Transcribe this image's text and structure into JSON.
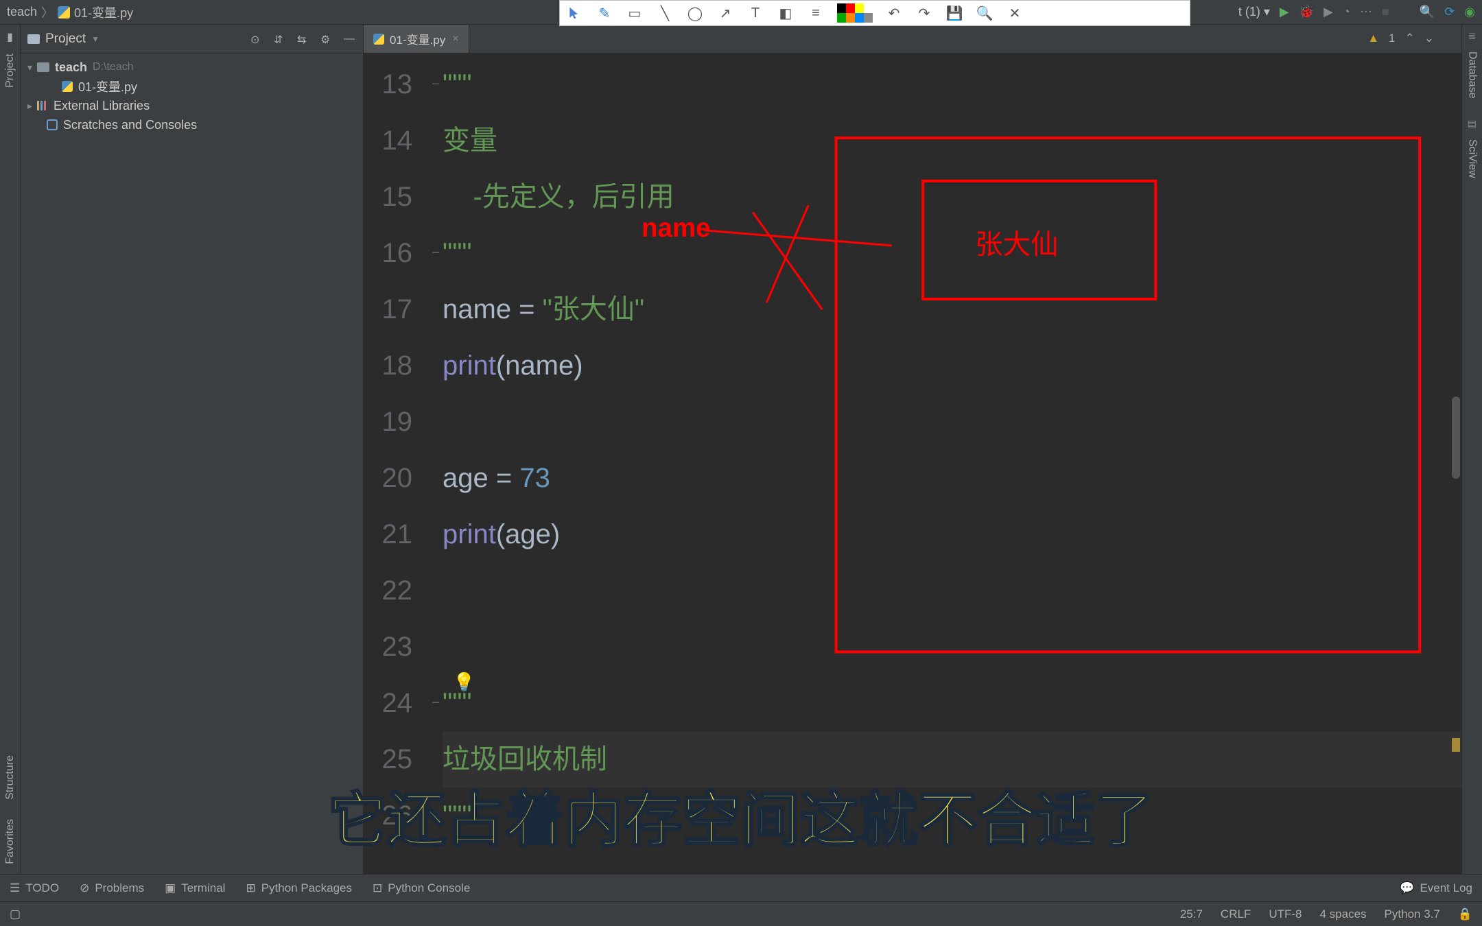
{
  "breadcrumb": {
    "project": "teach",
    "file": "01-变量.py"
  },
  "toolbar_right": {
    "run_config": "t (1)"
  },
  "project_panel": {
    "title": "Project",
    "root": {
      "name": "teach",
      "path": "D:\\teach"
    },
    "files": [
      "01-变量.py"
    ],
    "external": "External Libraries",
    "scratches": "Scratches and Consoles"
  },
  "tabs": [
    {
      "name": "01-变量.py"
    }
  ],
  "inspections": {
    "warn_count": "1"
  },
  "code_lines": [
    {
      "n": 13,
      "html": "<span class='s-doc'>\"\"\"</span>",
      "fold": "−"
    },
    {
      "n": 14,
      "html": "<span class='s-doc'>变量</span>"
    },
    {
      "n": 15,
      "html": "<span class='s-doc'>    -先定义，后引用</span>"
    },
    {
      "n": 16,
      "html": "<span class='s-doc'>\"\"\"</span>",
      "fold": "−"
    },
    {
      "n": 17,
      "html": "name = <span class='s-str'>\"张大仙\"</span>"
    },
    {
      "n": 18,
      "html": "<span class='s-fn'>print</span>(name)"
    },
    {
      "n": 19,
      "html": ""
    },
    {
      "n": 20,
      "html": "age = <span class='s-num'>73</span>"
    },
    {
      "n": 21,
      "html": "<span class='s-fn'>print</span>(age)"
    },
    {
      "n": 22,
      "html": ""
    },
    {
      "n": 23,
      "html": ""
    },
    {
      "n": 24,
      "html": "<span class='s-doc'>\"\"\"</span>",
      "fold": "−"
    },
    {
      "n": 25,
      "html": "<span class='s-doc'>垃圾回收机制</span>",
      "caret": true
    },
    {
      "n": 26,
      "html": "<span class='s-doc'>\"\"\"</span>",
      "fold": "−"
    }
  ],
  "annotation": {
    "label_text": "name",
    "box_text": "张大仙",
    "color": "#ff0000"
  },
  "subtitle": "它还占着内存空间这就不合适了",
  "bottom_tools": {
    "todo": "TODO",
    "problems": "Problems",
    "terminal": "Terminal",
    "packages": "Python Packages",
    "console": "Python Console",
    "eventlog": "Event Log"
  },
  "statusbar": {
    "pos": "25:7",
    "eol": "CRLF",
    "enc": "UTF-8",
    "indent": "4 spaces",
    "interp": "Python 3.7"
  },
  "side_tools": {
    "left": [
      "Project",
      "Structure",
      "Favorites"
    ],
    "right": [
      "Database",
      "SciView"
    ]
  }
}
